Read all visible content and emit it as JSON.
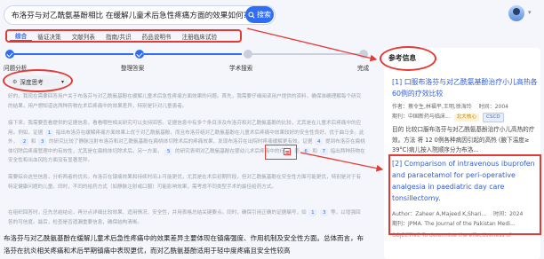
{
  "search": {
    "query": "布洛芬与对乙酰氨基酚相比 在缓解儿童术后急性疼痛方面的效果如何?",
    "button_label": "搜索"
  },
  "tabs": [
    "综合",
    "循证决策",
    "文献列表",
    "指南/共识",
    "药品说明书",
    "注册临床试验"
  ],
  "steps": [
    "问题分析",
    "整理答案",
    "学术搜索",
    "完成"
  ],
  "reasoning": {
    "label": "深度思考"
  },
  "body_paras": [
    "好的，我现在需要回答用户关于布洛芬与对乙酰氨基酚在缓解儿童术后急性疼痛方面效果的问题。首先，我需要仔细阅读用户提供的资料，确保准确理解每个研究的结果，用户想知道这两种药物在术后疼痛中的效果差异，特别是针对儿童患者。",
    "接下来，我需要查看提供的证据信息，看看哪些相关研究可以支持回答。证据信息中有多个条目涉及布洛芬和对乙酰氨基酚的比较，尤其是在儿童术后疼痛中的应用。例如，证据",
    "指出布洛芬在缓解疼痛方面效果上优于对乙酰氨基酚，而且布洛芬组对乙酰氨基酚在儿童术后疼痛中效果较好的安全性良好，优于曲马多。此外，",
    "和",
    "的研究比较了静脉注射布洛芬和对乙酰氨基酚在扁桃体切除术后的疼痛效果，发现布洛芬在出院时疼痛缓解更有效。证据",
    "提到布洛芬在扁桃体切除后疼痛管理中的有效性，尤其是在扁桃体切除术后。另一方面，",
    "的研究表明对乙酰氨基酚在婴幼儿术后疼痛中的疗效。而",
    "和",
    "指出两种药物在安全性和出血风险方面没有显著差异。",
    "需要综合这些信息，分析两者的优劣。布洛芬在镇痛效果和持续时间上可能更优，尤其是在术后初期阶段，但对乙酰氨基酚在安全性方面可能更优，特别是对于有特定健康问题的儿童。同时，不同的给药方式（如静脉注射或口服）可能影响效果，需考虑不同类型手术的最佳给药方式。",
    "在组织回答时，应先总结结论，再分点详细比较效果、适用情况、安全性，并用表格总结关键要点。同时，确保引用正确的证据编号，如",
    "等，以增强回答的可信度。最后，检查是否遗漏重要信息，确保结构清晰。"
  ],
  "refs": [
    "1",
    "2",
    "3",
    "4",
    "5",
    "6",
    "7",
    "1",
    "3"
  ],
  "answer": "布洛芬与对乙酰氨基酚在缓解儿童术后急性疼痛中的效果差异主要体现在镇痛强度、作用机制及安全性方面。总体而言，布洛芬在抗炎相关疼痛和术后早期镇痛中表现更优，而对乙酰氨基酚适用于轻中度疼痛且安全性较高",
  "panel": {
    "title": "参考信息",
    "cards": [
      {
        "num": "[1]",
        "title": "口服布洛芬与对乙酰氨基酚治疗小儿高热各60例的疗效比较",
        "author_label": "作者：",
        "authors": "蔡令生,林福平,王明,徐海玲",
        "time_label": "时间：",
        "year": "2004",
        "journal_label": "期刊：",
        "journal": "中国新药与临床...",
        "tags": [
          "北大核心",
          "CSCD"
        ],
        "abstract": "目的 比较口服布洛芬与对乙酰氨基酚治疗小儿高热的疗效。方法 将 12 0例各种病因引起的高热 (腋下温度≥ 39°C)病儿按入院顺序分为布洛..."
      },
      {
        "num": "[2]",
        "title": "Comparison of intravenous ibuprofen and paracetamol for peri-operative analgesia in paediatric day care tonsillectomy.",
        "author_label": "Author：",
        "authors": "Zaheer A,Majeed K,Shari...",
        "time_label": "时间：",
        "year": "2024",
        "journal_label": "期刊：",
        "journal": "JPMA. The Journal of the Pakistan Medi...",
        "tags": [],
        "abstract": "OBJECTIVE To determine the effectiveness of"
      }
    ]
  },
  "colors": {
    "accent": "#2f6ef4",
    "annotation": "#e53935",
    "link": "#2f5cd6"
  }
}
